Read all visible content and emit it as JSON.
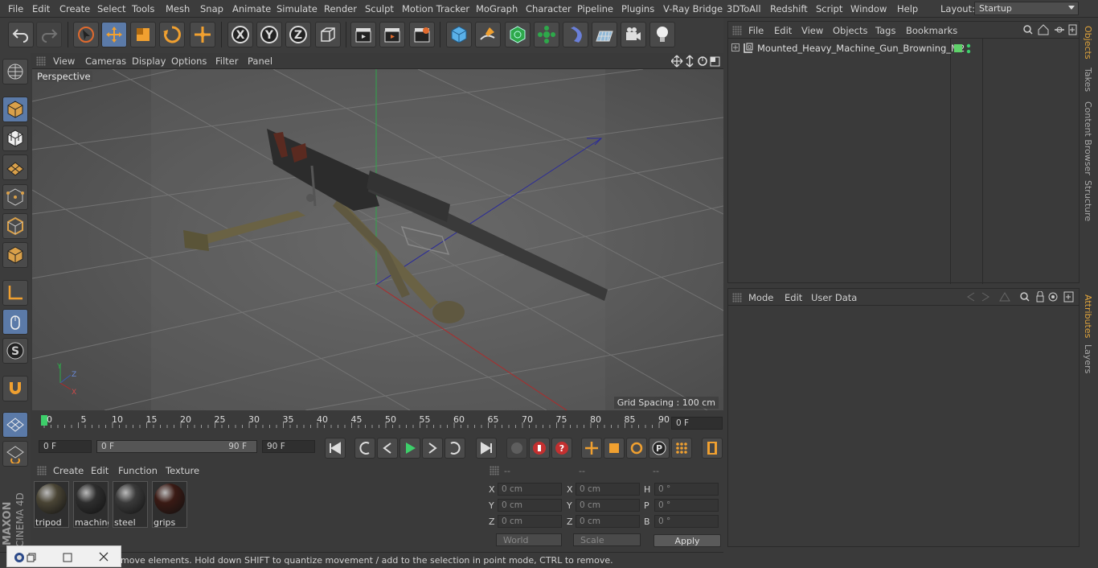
{
  "menubar": {
    "items": [
      "File",
      "Edit",
      "Create",
      "Select",
      "Tools",
      "Mesh",
      "Snap",
      "Animate",
      "Simulate",
      "Render",
      "Sculpt",
      "Motion Tracker",
      "MoGraph",
      "Character",
      "Pipeline",
      "Plugins",
      "V-Ray Bridge",
      "3DToAll",
      "Redshift",
      "Script",
      "Window",
      "Help"
    ],
    "layout_label": "Layout:",
    "layout_value": "Startup"
  },
  "viewport": {
    "menu": [
      "View",
      "Cameras",
      "Display",
      "Options",
      "Filter",
      "Panel"
    ],
    "label": "Perspective",
    "grid_spacing": "Grid Spacing : 100 cm"
  },
  "timeline": {
    "ticks": [
      "0",
      "5",
      "10",
      "15",
      "20",
      "25",
      "30",
      "35",
      "40",
      "45",
      "50",
      "55",
      "60",
      "65",
      "70",
      "75",
      "80",
      "85",
      "90"
    ],
    "current_frame": "0 F"
  },
  "transport": {
    "start_field": "0 F",
    "range_start": "0 F",
    "range_end": "90 F",
    "end_field": "90 F"
  },
  "materials": {
    "menu": [
      "Create",
      "Edit",
      "Function",
      "Texture"
    ],
    "items": [
      {
        "name": "tripod",
        "color": "#4a4535"
      },
      {
        "name": "machine",
        "color": "#2e2e2e"
      },
      {
        "name": "steel",
        "color": "#3a3a3a"
      },
      {
        "name": "grips",
        "color": "#3a1a14"
      }
    ]
  },
  "coords": {
    "headers": [
      "--",
      "--",
      "--"
    ],
    "rows": [
      {
        "l1": "X",
        "v1": "0 cm",
        "l2": "X",
        "v2": "0 cm",
        "l3": "H",
        "v3": "0 °"
      },
      {
        "l1": "Y",
        "v1": "0 cm",
        "l2": "Y",
        "v2": "0 cm",
        "l3": "P",
        "v3": "0 °"
      },
      {
        "l1": "Z",
        "v1": "0 cm",
        "l2": "Z",
        "v2": "0 cm",
        "l3": "B",
        "v3": "0 °"
      }
    ],
    "world": "World",
    "scale": "Scale",
    "apply": "Apply"
  },
  "status": {
    "text": "move elements. Hold down SHIFT to quantize movement / add to the selection in point mode, CTRL to remove."
  },
  "object_manager": {
    "menu": [
      "File",
      "Edit",
      "View",
      "Objects",
      "Tags",
      "Bookmarks"
    ],
    "objects": [
      {
        "name": "Mounted_Heavy_Machine_Gun_Browning_M2",
        "layer_color": "#5fd16a"
      }
    ]
  },
  "attribute_manager": {
    "menu": [
      "Mode",
      "Edit",
      "User Data"
    ]
  },
  "right_tabs": [
    "Objects",
    "Takes",
    "Content Browser",
    "Structure",
    "Attributes",
    "Layers"
  ],
  "branding": {
    "maxon": "MAXON",
    "product": "CINEMA 4D"
  },
  "colors": {
    "accent_blue": "#5b7aa8",
    "tab_orange": "#e0a43c",
    "playhead_green": "#3dcf6a"
  }
}
